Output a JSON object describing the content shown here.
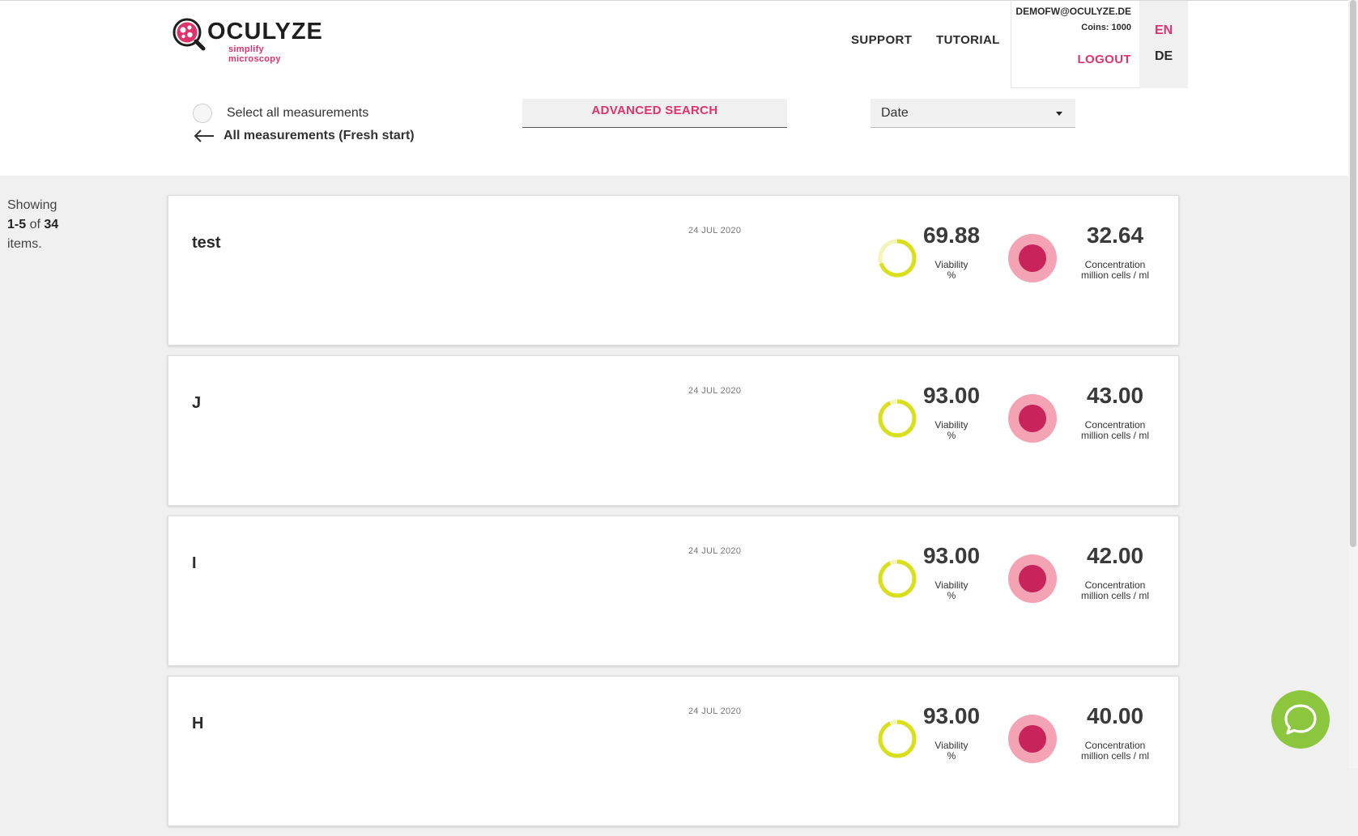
{
  "brand": {
    "name": "OCULYZE",
    "tagline": "simplify microscopy"
  },
  "nav": {
    "support": "SUPPORT",
    "tutorial": "TUTORIAL"
  },
  "user": {
    "email": "DEMOFW@OCULYZE.DE",
    "coins": "Coins: 1000",
    "logout": "LOGOUT"
  },
  "languages": {
    "en": "EN",
    "de": "DE",
    "active": "EN"
  },
  "toolbar": {
    "select_all": "Select all measurements",
    "back": "All measurements (Fresh start)",
    "advanced_search": "ADVANCED SEARCH",
    "sort_selected": "Date"
  },
  "pagination": {
    "prefix": "Showing",
    "range": "1-5",
    "of": "of",
    "total": "34",
    "suffix": "items."
  },
  "measurements": [
    {
      "title": "test",
      "date": "24 JUL 2020",
      "viability": "69.88",
      "viability_label": "Viability",
      "viability_unit": "%",
      "concentration": "32.64",
      "concentration_label": "Concentration",
      "concentration_unit": "million cells / ml"
    },
    {
      "title": "J",
      "date": "24 JUL 2020",
      "viability": "93.00",
      "viability_label": "Viability",
      "viability_unit": "%",
      "concentration": "43.00",
      "concentration_label": "Concentration",
      "concentration_unit": "million cells / ml"
    },
    {
      "title": "I",
      "date": "24 JUL 2020",
      "viability": "93.00",
      "viability_label": "Viability",
      "viability_unit": "%",
      "concentration": "42.00",
      "concentration_label": "Concentration",
      "concentration_unit": "million cells / ml"
    },
    {
      "title": "H",
      "date": "24 JUL 2020",
      "viability": "93.00",
      "viability_label": "Viability",
      "viability_unit": "%",
      "concentration": "40.00",
      "concentration_label": "Concentration",
      "concentration_unit": "million cells / ml"
    }
  ],
  "colors": {
    "accent": "#e0336b",
    "viability_ring": "#d9df1a",
    "viability_ring_light": "#f3f5b8",
    "concentration_outer": "#f4a3b5",
    "concentration_inner": "#c8235a",
    "chat": "#8cc63f"
  },
  "icons": {
    "back": "arrow-left-icon",
    "sort_caret": "caret-down-icon",
    "chat": "chat-bubble-icon",
    "logo": "magnifier-cell-icon"
  }
}
